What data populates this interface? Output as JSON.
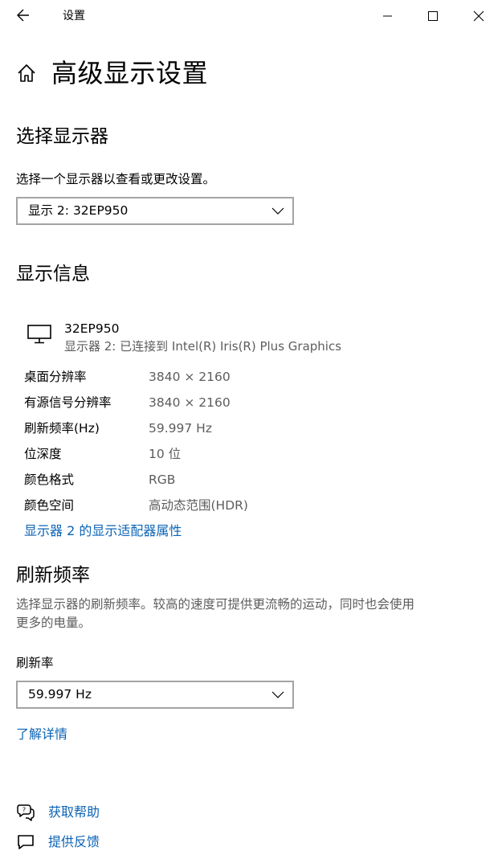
{
  "window": {
    "title": "设置"
  },
  "page": {
    "title": "高级显示设置"
  },
  "select_display": {
    "heading": "选择显示器",
    "description": "选择一个显示器以查看或更改设置。",
    "selected": "显示 2: 32EP950"
  },
  "display_info": {
    "heading": "显示信息",
    "monitor_name": "32EP950",
    "monitor_detail": "显示器 2: 已连接到 Intel(R) Iris(R) Plus Graphics",
    "rows": [
      {
        "label": "桌面分辨率",
        "value": "3840 × 2160"
      },
      {
        "label": "有源信号分辨率",
        "value": "3840 × 2160"
      },
      {
        "label": "刷新频率(Hz)",
        "value": "59.997 Hz"
      },
      {
        "label": "位深度",
        "value": "10 位"
      },
      {
        "label": "颜色格式",
        "value": "RGB"
      },
      {
        "label": "颜色空间",
        "value": "高动态范围(HDR)"
      }
    ],
    "adapter_link": "显示器 2 的显示适配器属性"
  },
  "refresh_rate": {
    "heading": "刷新频率",
    "description_line1": "选择显示器的刷新频率。较高的速度可提供更流畅的运动，同时也会使用",
    "description_line2": "更多的电量。",
    "field_label": "刷新率",
    "selected": "59.997 Hz",
    "learn_more": "了解详情"
  },
  "help": {
    "get_help": "获取帮助",
    "feedback": "提供反馈"
  },
  "colors": {
    "accent_link": "#0b63b5",
    "muted_text": "#5d5d5d",
    "dropdown_border": "#a4a4a4"
  }
}
